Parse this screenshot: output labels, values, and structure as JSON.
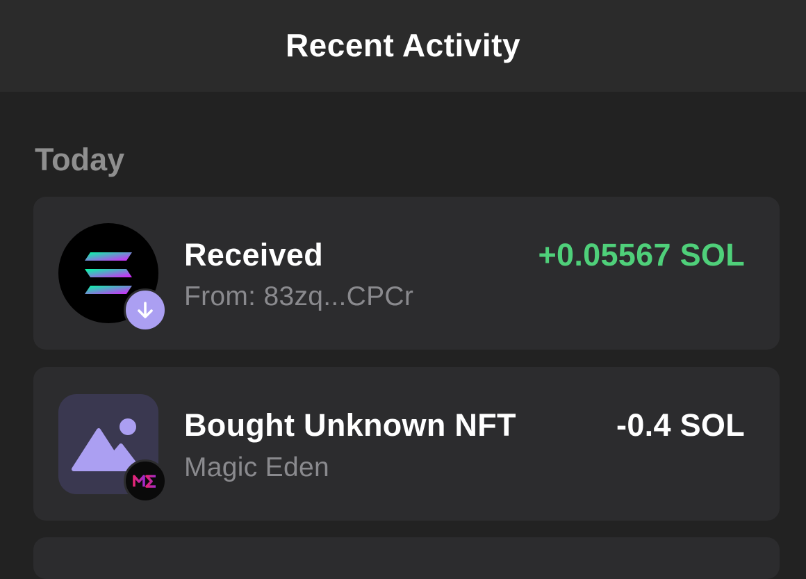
{
  "header": {
    "title": "Recent Activity"
  },
  "sections": [
    {
      "label": "Today",
      "items": [
        {
          "title": "Received",
          "subtitle": "From: 83zq...CPCr",
          "amount": "+0.05567 SOL",
          "amount_color": "#4fd07a",
          "icon": "solana-icon",
          "badge_icon": "arrow-down-icon"
        },
        {
          "title": "Bought Unknown NFT",
          "subtitle": "Magic Eden",
          "amount": "-0.4 SOL",
          "amount_color": "#ffffff",
          "icon": "image-placeholder-icon",
          "badge_icon": "magic-eden-logo-icon"
        }
      ]
    }
  ],
  "colors": {
    "background": "#222222",
    "header_bg": "#2b2b2b",
    "card_bg": "#2c2c2e",
    "accent_purple": "#ab9ff2",
    "positive_green": "#4fd07a"
  }
}
